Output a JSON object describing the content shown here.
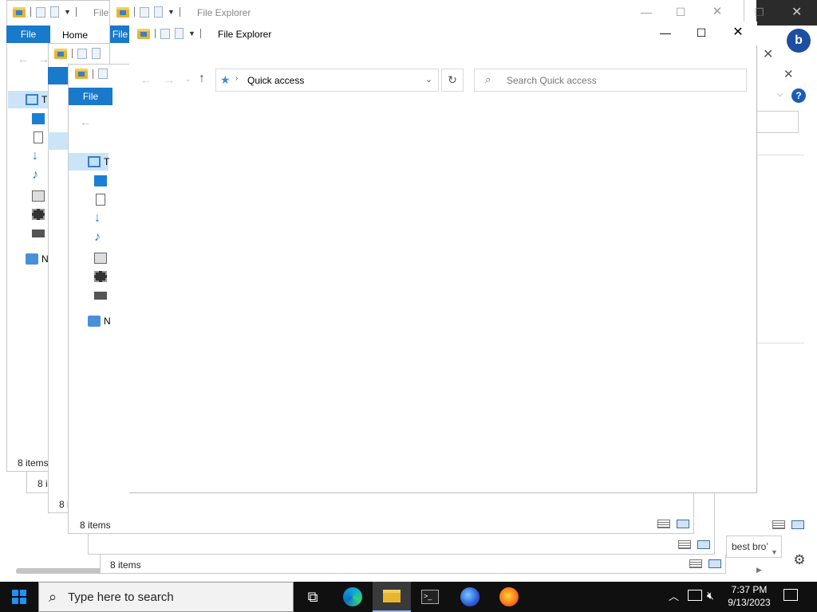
{
  "windows": {
    "title": "File Explorer",
    "truncated_title": "File",
    "ribbon_file": "File",
    "ribbon_home": "Home",
    "quick_access_label": "Quick access",
    "search_placeholder": "Search Quick access",
    "status_items": "8 items",
    "status_items_trunc1": "8 i",
    "status_items_trunc2": "8 i",
    "tree_letter_t": "T",
    "tree_letter_n": "N"
  },
  "browser_panel": {
    "search_text": "best broʼ"
  },
  "taskbar": {
    "search_placeholder": "Type here to search",
    "time": "7:37 PM",
    "date": "9/13/2023"
  },
  "icons": [
    "windows-logo-icon",
    "search-icon",
    "task-view-icon",
    "edge-icon",
    "file-explorer-icon",
    "terminal-icon",
    "firefox-dev-icon",
    "firefox-icon",
    "chevron-up-icon",
    "network-icon",
    "volume-muted-icon",
    "notification-icon"
  ],
  "colors": {
    "accent": "#1979ca",
    "taskbar": "#101010"
  }
}
